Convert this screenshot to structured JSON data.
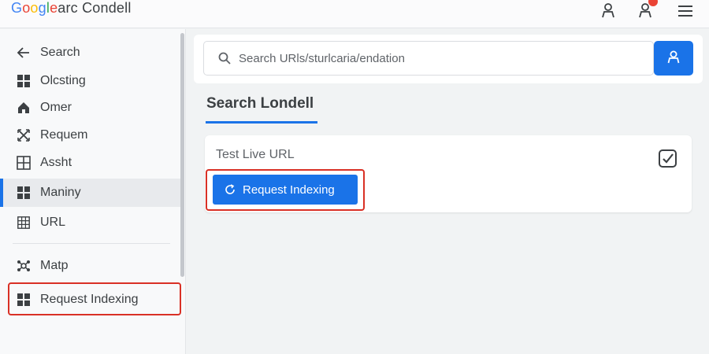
{
  "app": {
    "logo_parts": [
      "G",
      "o",
      "o",
      "g",
      "l",
      "e"
    ],
    "logo_rest": "arc Condell"
  },
  "header": {
    "icons": [
      "person-icon",
      "account-alert-icon",
      "hamburger-menu-icon"
    ]
  },
  "sidebar": {
    "items": [
      {
        "label": "Search",
        "icon": "arrow-left-icon"
      },
      {
        "label": "Olcsting",
        "icon": "grid-icon"
      },
      {
        "label": "Omer",
        "icon": "home-icon"
      },
      {
        "label": "Requem",
        "icon": "cross-arrows-icon"
      },
      {
        "label": "Assht",
        "icon": "table-icon"
      },
      {
        "label": "Maniny",
        "icon": "grid-icon",
        "active": true
      },
      {
        "label": "URL",
        "icon": "grid-dots-icon"
      },
      {
        "label": "Matp",
        "icon": "sitemap-icon"
      },
      {
        "label": "Request Indexing",
        "icon": "grid-icon",
        "highlighted": true
      }
    ]
  },
  "search": {
    "placeholder": "Search URls/sturlcaria/endation",
    "button_icon": "person-icon"
  },
  "main": {
    "section_title": "Search Londell",
    "card": {
      "label": "Test Live URL",
      "check_icon": "checkbox-checked-icon",
      "button_label": "Request Indexing",
      "button_icon": "refresh-icon"
    }
  },
  "colors": {
    "accent": "#1a73e8",
    "highlight": "#d93025",
    "background": "#f1f3f4"
  }
}
